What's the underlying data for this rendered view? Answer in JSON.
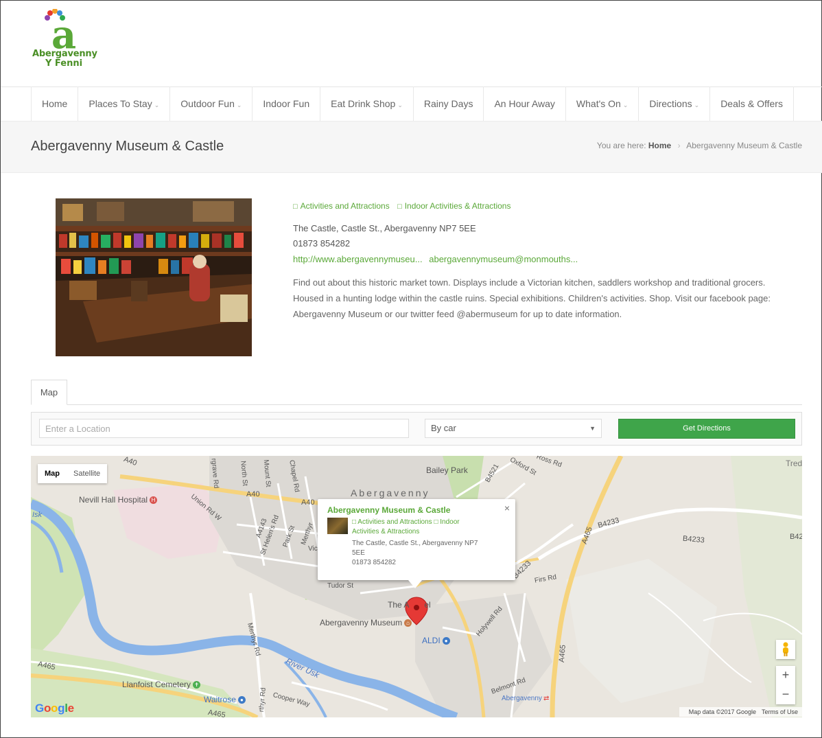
{
  "logo": {
    "line1": "Abergavenny",
    "line2": "Y Fenni"
  },
  "nav": [
    {
      "label": "Home",
      "dropdown": false
    },
    {
      "label": "Places To Stay",
      "dropdown": true
    },
    {
      "label": "Outdoor Fun",
      "dropdown": true
    },
    {
      "label": "Indoor Fun",
      "dropdown": false
    },
    {
      "label": "Eat Drink Shop",
      "dropdown": true
    },
    {
      "label": "Rainy Days",
      "dropdown": false
    },
    {
      "label": "An Hour Away",
      "dropdown": false
    },
    {
      "label": "What's On",
      "dropdown": true
    },
    {
      "label": "Directions",
      "dropdown": true
    },
    {
      "label": "Deals & Offers",
      "dropdown": false
    }
  ],
  "page": {
    "title": "Abergavenny Museum & Castle",
    "breadcrumb_prefix": "You are here:",
    "breadcrumb_home": "Home",
    "breadcrumb_current": "Abergavenny Museum & Castle"
  },
  "listing": {
    "categories": [
      "Activities and Attractions",
      "Indoor Activities & Attractions"
    ],
    "address": "The Castle, Castle St., Abergavenny NP7 5EE",
    "phone": "01873 854282",
    "website": "http://www.abergavennymuseu...",
    "email": "abergavennymuseum@monmouths...",
    "description": "Find out about this historic market town. Displays include a Victorian kitchen, saddlers workshop and traditional grocers. Housed in a hunting lodge within the castle ruins. Special exhibitions. Children's activities. Shop.  Visit our facebook page: Abergavenny Museum or our twitter feed  @abermuseum  for up to date information."
  },
  "tabs": {
    "map": "Map"
  },
  "directions": {
    "placeholder": "Enter a Location",
    "mode": "By car",
    "button": "Get Directions"
  },
  "map": {
    "type_map": "Map",
    "type_satellite": "Satellite",
    "labels": {
      "hospital": "Nevill Hall Hospital",
      "town": "Abergavenny",
      "bailey_park": "Bailey Park",
      "museum": "Abergavenny Museum",
      "aldi": "ALDI",
      "cemetery": "Llanfoist Cemetery",
      "waitrose": "Waitrose",
      "river": "River Usk",
      "the_castle": "The A",
      "the_castle_end": "el",
      "a40_1": "A40",
      "a40_2": "A40",
      "a40_3": "A40",
      "a465_1": "A465",
      "a465_2": "A465",
      "a465_3": "A465",
      "a465_4": "A465",
      "b4233_1": "B4233",
      "b4233_2": "B4233",
      "b4233_3": "B42",
      "b4233_4": "B4233",
      "a4143": "A4143",
      "b4521": "B4521",
      "union_rd": "Union Rd W",
      "st_helens": "St Helen's Rd",
      "park_st": "Park St",
      "merthyr": "Merthyr",
      "merthyr_rd": "Merthyr Rd",
      "merthyr_rd2": "rthyr Rd",
      "tudor_st": "Tudor St",
      "firs_rd": "Firs Rd",
      "holywell_rd": "Holywell Rd",
      "belmont_rd": "Belmont Rd",
      "station": "Abergavenny",
      "cooper_way": "Cooper Way",
      "oxford_st": "Oxford St",
      "chapel_rd": "Chapel Rd",
      "north_st": "North St",
      "mount_st": "Mount St",
      "pen_y_pound": "rgrave Rd",
      "usk_left": "Isk",
      "tred": "Tred",
      "vic": "Vic",
      "ross_rd": "Ross Rd"
    },
    "info": {
      "title": "Abergavenny Museum & Castle",
      "cat1": "Activities and Attractions",
      "cat2": "Indoor",
      "cat2b": "Activities & Attractions",
      "address1": "The Castle, Castle St., Abergavenny NP7",
      "address2": "5EE",
      "phone": "01873 854282"
    },
    "zoom_in": "+",
    "zoom_out": "−",
    "close": "×",
    "google": "Google",
    "attribution": "Map data ©2017 Google",
    "terms": "Terms of Use"
  },
  "colors": {
    "accent": "#5aa838",
    "button": "#3fa54a",
    "river": "#8ab4e8",
    "park": "#c8dfae"
  }
}
